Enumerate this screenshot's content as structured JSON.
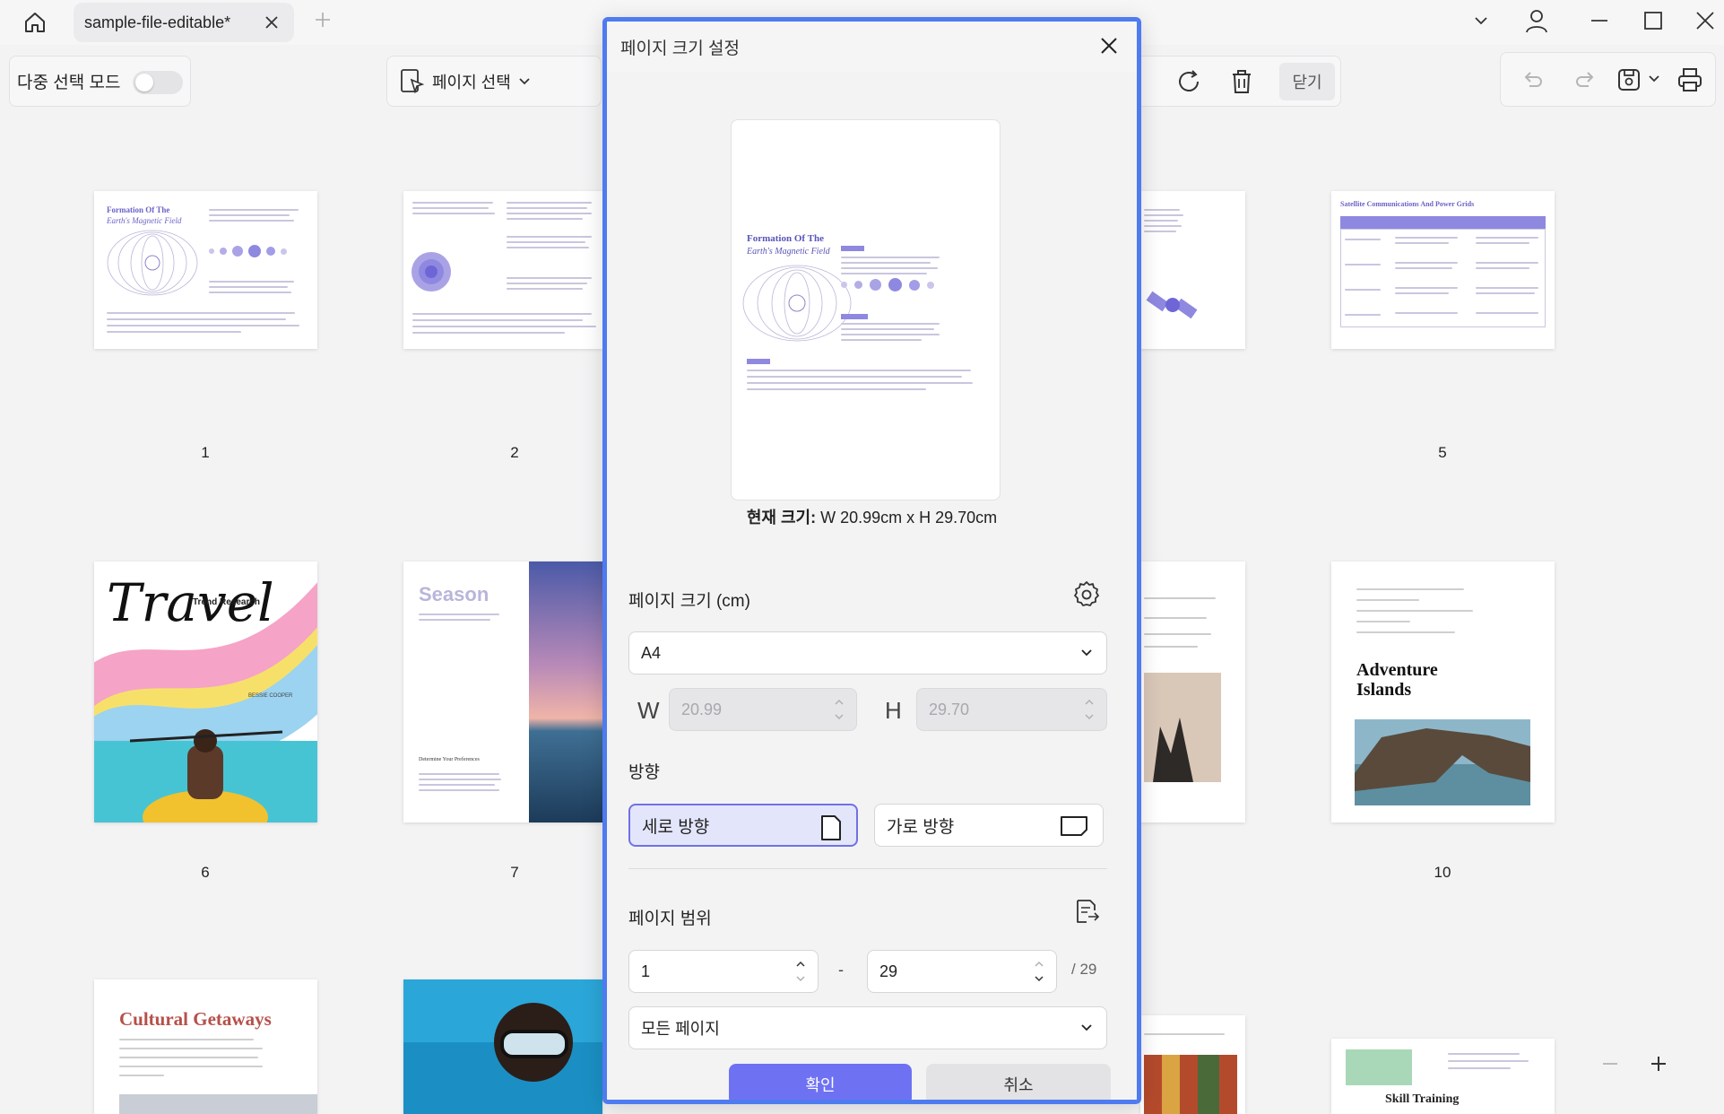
{
  "titlebar": {
    "tab_title": "sample-file-editable*"
  },
  "toolbar": {
    "multi_select_label": "다중 선택 모드",
    "page_select_label": "페이지 선택",
    "close_label": "닫기"
  },
  "thumbnails": {
    "page_numbers": [
      "1",
      "2",
      "5",
      "6",
      "7",
      "10"
    ],
    "p1_title": "Formation Of The",
    "p1_subtitle": "Earth's Magnetic Field",
    "p5_title": "Satellite Communications And Power Grids",
    "p6_title": "Travel",
    "p6_badge": "Trend Research",
    "p6_author": "BESSIE COOPER",
    "p7_title": "Season",
    "p7_text": "Determine Your Preferences",
    "p10_title": "Adventure Islands",
    "p11_title": "Cultural Getaways",
    "p15_title": "Skill Training"
  },
  "dialog": {
    "title": "페이지 크기 설정",
    "preview_title": "Formation Of The",
    "preview_subtitle": "Earth's Magnetic Field",
    "current_size_label": "현재 크기:",
    "current_size_value": "W 20.99cm x H 29.70cm",
    "page_size_label": "페이지 크기 (cm)",
    "paper_size": "A4",
    "width_letter": "W",
    "width_value": "20.99",
    "height_letter": "H",
    "height_value": "29.70",
    "orientation_label": "방향",
    "portrait_label": "세로 방향",
    "landscape_label": "가로 방향",
    "page_range_label": "페이지 범위",
    "range_from": "1",
    "range_dash": "-",
    "range_to": "29",
    "range_total": "/ 29",
    "range_option": "모든 페이지",
    "confirm_label": "확인",
    "cancel_label": "취소"
  },
  "colors": {
    "accent": "#6e72f2",
    "dialog_border": "#4f7bf0",
    "selected_bg": "#e3e5fb"
  }
}
